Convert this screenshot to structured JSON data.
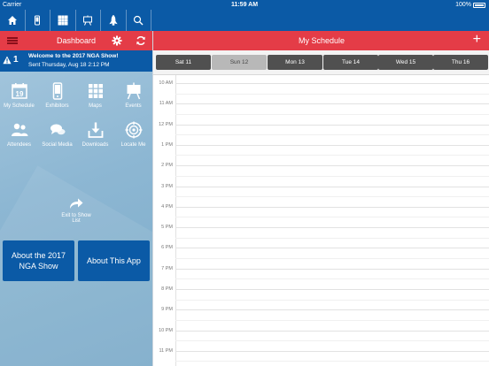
{
  "status": {
    "carrier": "Carrier",
    "time": "11:59 AM",
    "battery": "100%"
  },
  "nav_icons": [
    "home-icon",
    "phone-icon",
    "grid-icon",
    "easel-icon",
    "rocket-icon",
    "search-icon"
  ],
  "dashboard": {
    "title": "Dashboard"
  },
  "alert": {
    "count": "1",
    "message": "Welcome to the 2017 NGA Show!",
    "sent": "Sent Thursday, Aug 18 2:12 PM"
  },
  "menu": [
    {
      "label": "My Schedule",
      "icon": "calendar-icon",
      "day": "19"
    },
    {
      "label": "Exhibitors",
      "icon": "phone-icon"
    },
    {
      "label": "Maps",
      "icon": "grid-icon"
    },
    {
      "label": "Events",
      "icon": "easel-icon"
    },
    {
      "label": "Attendees",
      "icon": "people-icon"
    },
    {
      "label": "Social Media",
      "icon": "chat-icon"
    },
    {
      "label": "Downloads",
      "icon": "download-icon"
    },
    {
      "label": "Locate Me",
      "icon": "target-icon"
    }
  ],
  "exit": {
    "label": "Exit to Show List"
  },
  "buttons": {
    "about_show": "About the 2017 NGA Show",
    "about_app": "About This App"
  },
  "schedule": {
    "title": "My Schedule",
    "add": "+",
    "days": [
      "Sat 11",
      "Sun 12",
      "Mon 13",
      "Tue 14",
      "Wed 15",
      "Thu 16"
    ],
    "selected_day": "Sun 12",
    "hours": [
      "10 AM",
      "11 AM",
      "12 PM",
      "1 PM",
      "2 PM",
      "3 PM",
      "4 PM",
      "5 PM",
      "6 PM",
      "7 PM",
      "8 PM",
      "9 PM",
      "10 PM",
      "11 PM"
    ]
  },
  "colors": {
    "blue": "#0b5aa6",
    "red": "#e43c47",
    "panel": "#8db7d3"
  }
}
